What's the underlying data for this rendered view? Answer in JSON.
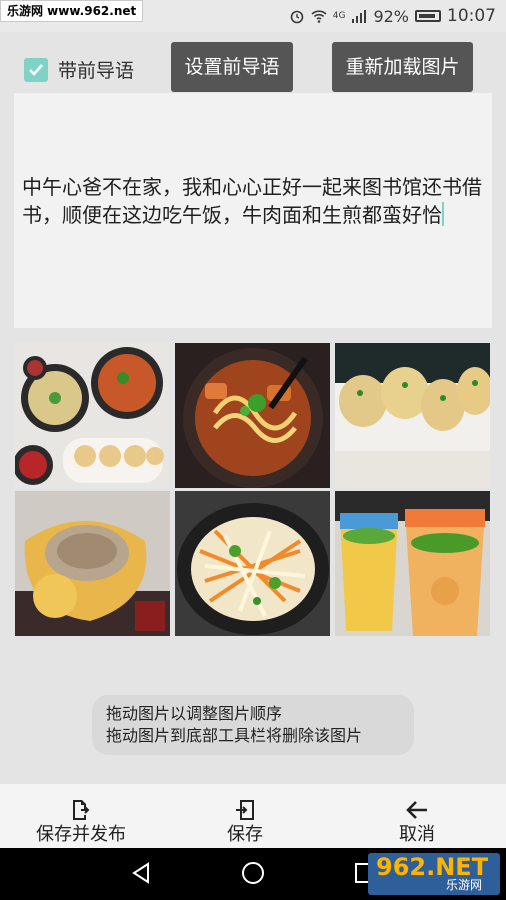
{
  "watermark_top": "乐游网 www.962.net",
  "status": {
    "signal": "4G",
    "battery": "92%",
    "time": "10:07"
  },
  "header": {
    "checkbox_label": "带前导语",
    "checkbox_checked": true,
    "set_guide_label": "设置前导语",
    "reload_label": "重新加载图片"
  },
  "editor": {
    "text": "中午心爸不在家，我和心心正好一起来图书馆还书借书，顺便在这边吃午饭，牛肉面和生煎都蛮好恰"
  },
  "photos": [
    {
      "subject": "noodles-and-dumplings-set"
    },
    {
      "subject": "beef-noodle-soup"
    },
    {
      "subject": "pan-fried-buns"
    },
    {
      "subject": "bun-closeup"
    },
    {
      "subject": "shredded-vegetable-salad"
    },
    {
      "subject": "fruit-drinks"
    }
  ],
  "hint": {
    "line1": "拖动图片以调整图片顺序",
    "line2": "拖动图片到底部工具栏将删除该图片"
  },
  "toolbar": {
    "publish_label": "保存并发布",
    "save_label": "保存",
    "cancel_label": "取消"
  },
  "watermark_bottom": {
    "big": "962.NET",
    "small": "乐游网"
  },
  "colors": {
    "accent": "#7fd3c4",
    "button": "#555555"
  }
}
